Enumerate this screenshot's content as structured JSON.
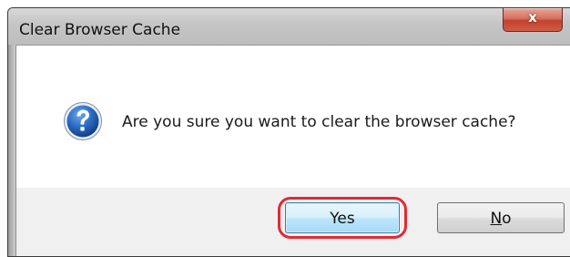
{
  "window": {
    "title": "Clear Browser Cache",
    "close_glyph": "x"
  },
  "dialog": {
    "icon": "question-icon",
    "message": "Are you sure you want to clear the browser cache?"
  },
  "buttons": {
    "yes_label": "Yes",
    "no_label_underlined": "N",
    "no_label_rest": "o"
  },
  "annotation": {
    "highlighted_button": "yes",
    "highlight_color": "#e22a34"
  },
  "colors": {
    "icon_blue": "#1f5fb5",
    "close_red": "#c2412d",
    "default_button_border": "#3c7fb1"
  }
}
